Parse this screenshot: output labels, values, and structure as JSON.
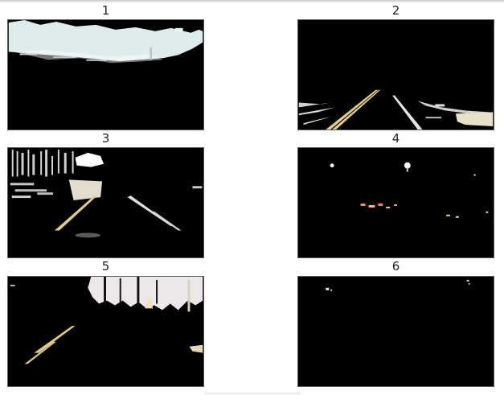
{
  "figure": {
    "panels": [
      {
        "title": "1",
        "scene": "sky-mask"
      },
      {
        "title": "2",
        "scene": "highway-lanes"
      },
      {
        "title": "3",
        "scene": "street-trees"
      },
      {
        "title": "4",
        "scene": "night-lights"
      },
      {
        "title": "5",
        "scene": "tree-silhouette"
      },
      {
        "title": "6",
        "scene": "dark-sparse"
      }
    ]
  }
}
